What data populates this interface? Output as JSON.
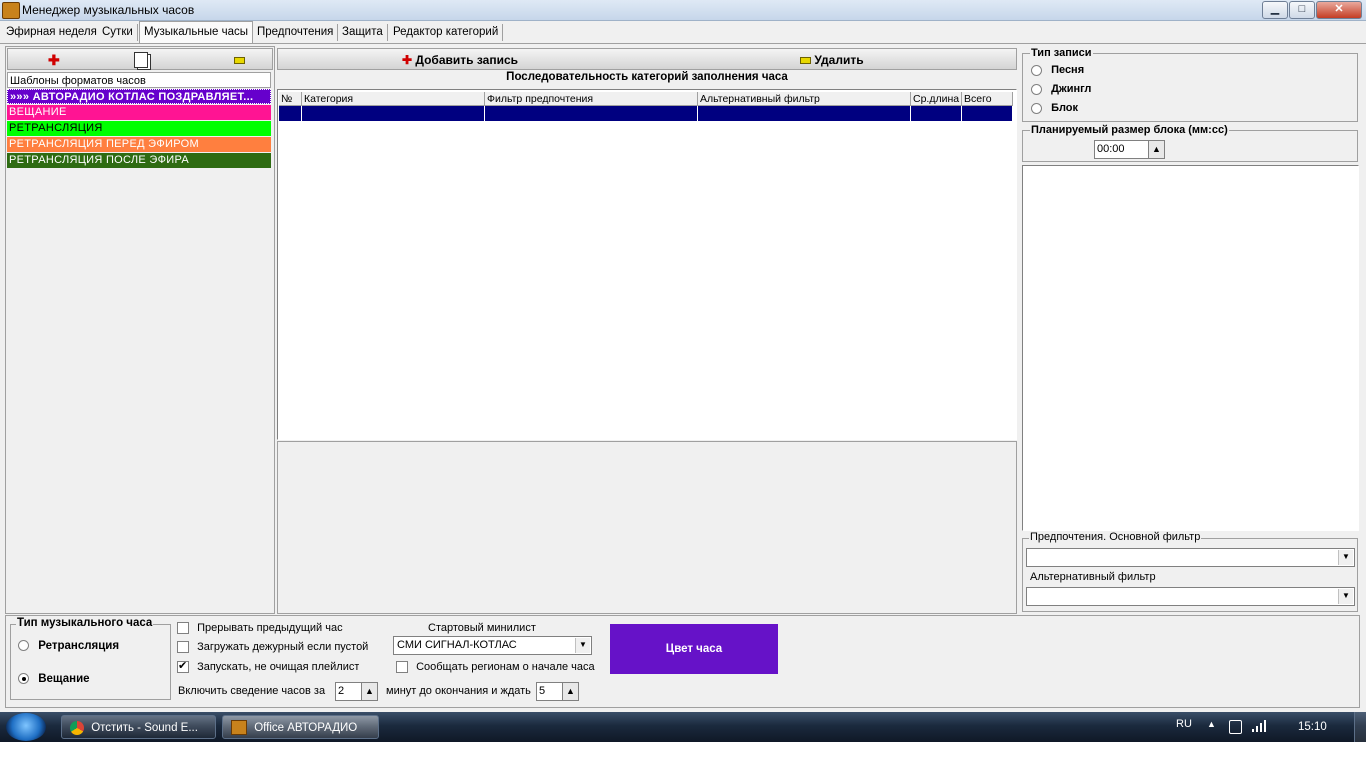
{
  "window": {
    "title": "Менеджер музыкальных часов",
    "min_label": "▁",
    "max_label": "□",
    "close_label": "✕"
  },
  "tabs": [
    {
      "label": "Эфирная неделя"
    },
    {
      "label": "Сутки"
    },
    {
      "label": "Музыкальные часы"
    },
    {
      "label": "Предпочтения"
    },
    {
      "label": "Защита"
    },
    {
      "label": "Редактор категорий"
    }
  ],
  "left_panel": {
    "list_header": "Шаблоны форматов часов",
    "templates": [
      {
        "label": "»»» АВТОРАДИО КОТЛАС ПОЗДРАВЛЯЕТ...",
        "bg": "#6600cc",
        "fg": "#ffffff"
      },
      {
        "label": "ВЕЩАНИЕ",
        "bg": "#ff1493",
        "fg": "#ffffff"
      },
      {
        "label": "РЕТРАНСЛЯЦИЯ",
        "bg": "#00ff00",
        "fg": "#000000"
      },
      {
        "label": "РЕТРАНСЛЯЦИЯ ПЕРЕД ЭФИРОМ",
        "bg": "#ff7f3f",
        "fg": "#ffffff"
      },
      {
        "label": "РЕТРАНСЛЯЦИЯ ПОСЛЕ ЭФИРА",
        "bg": "#2e6b12",
        "fg": "#ffffff"
      }
    ]
  },
  "center": {
    "add_label": "Добавить запись",
    "delete_label": "Удалить",
    "sequence_title": "Последовательность категорий заполнения часа",
    "columns": [
      "№",
      "Категория",
      "Фильтр предпочтения",
      "Альтернативный фильтр",
      "Ср.длина",
      "Всего"
    ]
  },
  "right_panel": {
    "record_type_title": "Тип записи",
    "record_types": [
      {
        "label": "Песня",
        "checked": false
      },
      {
        "label": "Джингл",
        "checked": false
      },
      {
        "label": "Блок",
        "checked": false
      }
    ],
    "block_size_title": "Планируемый размер блока (мм:сс)",
    "block_size_value": "00:00",
    "main_filter_label": "Предпочтения. Основной фильтр",
    "main_filter_value": "",
    "alt_filter_label": "Альтернативный фильтр",
    "alt_filter_value": ""
  },
  "bottom": {
    "hour_type_title": "Тип музыкального часа",
    "hour_types": [
      {
        "label": "Ретрансляция",
        "checked": false
      },
      {
        "label": "Вещание",
        "checked": true
      }
    ],
    "checkboxes": [
      {
        "label": "Прерывать предыдущий час",
        "checked": false
      },
      {
        "label": "Загружать дежурный если пустой",
        "checked": false
      },
      {
        "label": "Запускать, не очищая плейлист",
        "checked": true
      }
    ],
    "start_minilist_label": "Стартовый минилист",
    "start_minilist_value": "СМИ СИГНАЛ-КОТЛАС",
    "notify_regions_label": "Сообщать регионам о начале часа",
    "notify_regions_checked": false,
    "mix_prefix": "Включить сведение часов за",
    "mix_minutes": "2",
    "mix_middle": "минут до окончания и ждать",
    "mix_wait": "5",
    "hour_color_label": "Цвет часа",
    "hour_color": "#6612c8"
  },
  "taskbar": {
    "items": [
      {
        "label": "Отстить - Sound E..."
      },
      {
        "label": "Office АВТОРАДИО"
      }
    ],
    "lang": "RU",
    "clock": "15:10"
  }
}
